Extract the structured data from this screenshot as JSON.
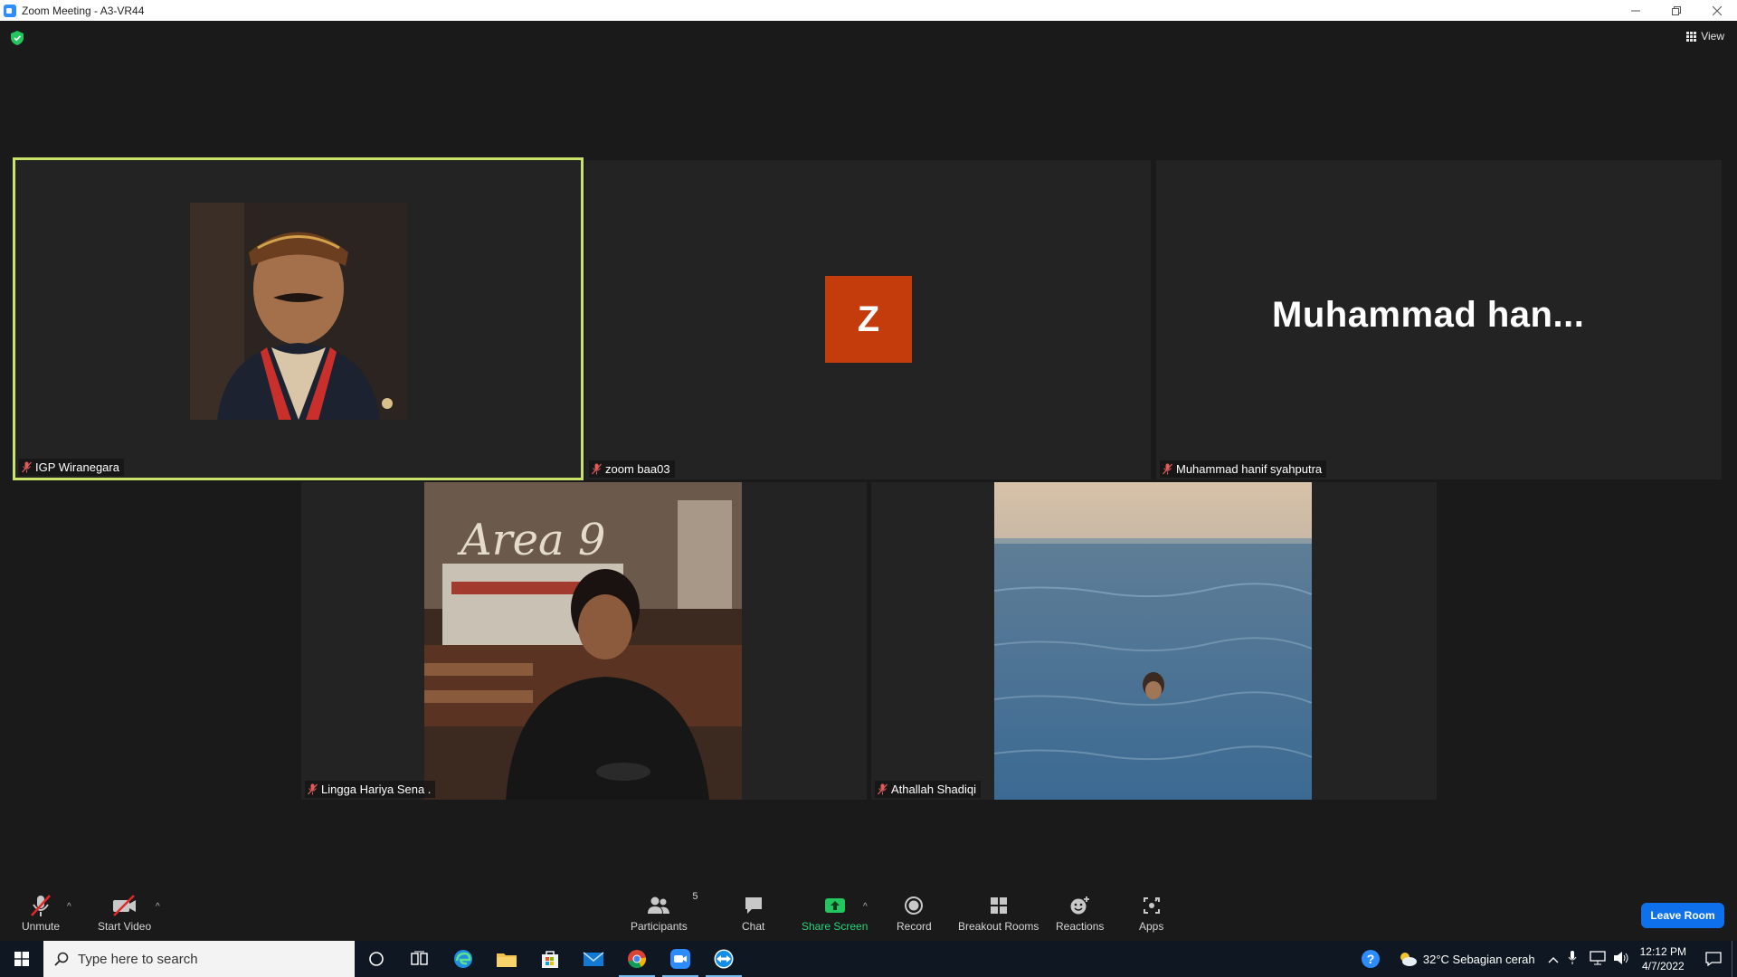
{
  "window": {
    "title": "Zoom Meeting - A3-VR44"
  },
  "header": {
    "view_label": "View"
  },
  "participants": [
    {
      "name": "IGP Wiranegara",
      "muted": true,
      "active_speaker": true
    },
    {
      "name": "zoom baa03",
      "muted": true,
      "avatar_letter": "Z"
    },
    {
      "name": "Muhammad hanif syahputra",
      "muted": true,
      "display_name": "Muhammad  han..."
    },
    {
      "name": "Lingga Hariya Sena .",
      "muted": true
    },
    {
      "name": "Athallah Shadiqi",
      "muted": true
    }
  ],
  "toolbar": {
    "unmute": "Unmute",
    "start_video": "Start Video",
    "participants": "Participants",
    "participants_count": "5",
    "chat": "Chat",
    "share_screen": "Share Screen",
    "record": "Record",
    "breakout_rooms": "Breakout Rooms",
    "reactions": "Reactions",
    "apps": "Apps",
    "leave": "Leave Room"
  },
  "taskbar": {
    "search_placeholder": "Type here to search",
    "weather": "32°C  Sebagian cerah",
    "time": "12:12 PM",
    "date": "4/7/2022"
  },
  "colors": {
    "active_border": "#c9e26a",
    "avatar_bg": "#c43b0c",
    "share_green": "#29d37a",
    "leave_blue": "#0e71eb"
  }
}
